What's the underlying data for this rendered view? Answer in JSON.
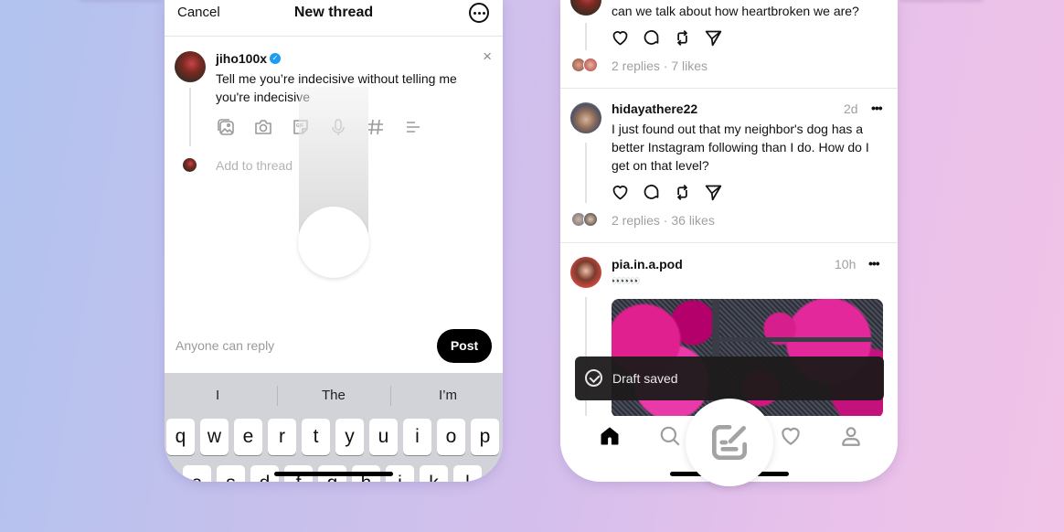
{
  "composer": {
    "cancel_label": "Cancel",
    "title": "New thread",
    "more_icon": "more-circle-icon",
    "username": "jiho100x",
    "verified": true,
    "text": "Tell me you’re indecisive without telling me you're indecisive",
    "attachments": [
      "gallery-icon",
      "camera-icon",
      "gif-icon",
      "microphone-icon",
      "hashtag-icon",
      "list-icon"
    ],
    "add_to_thread_placeholder": "Add to thread",
    "reply_setting": "Anyone can reply",
    "post_label": "Post"
  },
  "keyboard": {
    "suggestions": [
      "I",
      "The",
      "I’m"
    ],
    "row1": [
      "q",
      "w",
      "e",
      "r",
      "t",
      "y",
      "u",
      "i",
      "o",
      "p"
    ],
    "row2": [
      "a",
      "s",
      "d",
      "f",
      "g",
      "h",
      "j",
      "k",
      "l"
    ]
  },
  "feed": {
    "posts": [
      {
        "username": "",
        "text": "can we talk about how heartbroken we are?",
        "stats": "2 replies · 7 likes"
      },
      {
        "username": "hidayathere22",
        "time": "2d",
        "text": "I just found out that my neighbor's dog has a better Instagram following than I do. How do I get on that level?",
        "stats": "2 replies · 36 likes"
      },
      {
        "username": "pia.in.a.pod",
        "time": "10h",
        "caption": "👀👀👀",
        "has_image": true
      }
    ],
    "more_label": "•••"
  },
  "toast": {
    "icon": "check-circle-icon",
    "text": "Draft saved"
  },
  "tabbar": {
    "tabs": [
      "home",
      "search",
      "compose",
      "activity",
      "profile"
    ],
    "active": "home"
  }
}
